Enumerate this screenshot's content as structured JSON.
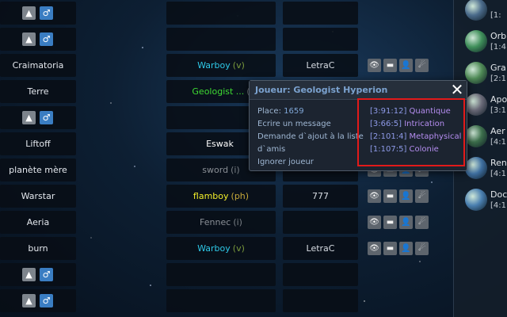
{
  "colors": {
    "player_cyan": "#2ec9e8",
    "player_green": "#3edb32",
    "player_yellow": "#f2ee2a",
    "player_white": "#ffffff",
    "player_grey": "#8a8f96",
    "rank_v": "#7a9a3c",
    "rank_ph": "#c7a93a",
    "rank_i": "#7a7f86",
    "highlight": "#e21a1a"
  },
  "rows": [
    {
      "type": "empty"
    },
    {
      "type": "empty"
    },
    {
      "type": "planet",
      "planet": "Craimatoria",
      "player": "Warboy",
      "rank": "(v)",
      "color": "player_cyan",
      "alliance": "LetraC",
      "actions": true
    },
    {
      "type": "planet",
      "planet": "Terre",
      "player": "Geologist ...",
      "rank": "(",
      "color": "player_green",
      "alliance": "",
      "actions": false
    },
    {
      "type": "empty"
    },
    {
      "type": "planet",
      "planet": "Liftoff",
      "player": "Eswak",
      "rank": "",
      "color": "player_white",
      "alliance": "",
      "actions": false
    },
    {
      "type": "planet",
      "planet": "planète mère",
      "player": "sword",
      "rank": "(i)",
      "color": "player_grey",
      "alliance": "",
      "actions": true
    },
    {
      "type": "planet",
      "planet": "Warstar",
      "player": "flamboy",
      "rank": "(ph)",
      "color": "player_yellow",
      "alliance": "777",
      "actions": true
    },
    {
      "type": "planet",
      "planet": "Aeria",
      "player": "Fennec",
      "rank": "(i)",
      "color": "player_grey",
      "alliance": "",
      "actions": true
    },
    {
      "type": "planet",
      "planet": "burn",
      "player": "Warboy",
      "rank": "(v)",
      "color": "player_cyan",
      "alliance": "LetraC",
      "actions": true
    },
    {
      "type": "empty"
    },
    {
      "type": "empty"
    }
  ],
  "popup": {
    "title": "Joueur: Geologist Hyperion",
    "close_icon": "close-icon",
    "place_label": "Place:",
    "place_value": "1659",
    "write_message": "Ecrire un message",
    "add_friend_line1": "Demande d`ajout à la liste",
    "add_friend_line2": "d`amis",
    "ignore": "Ignorer joueur",
    "planets": [
      {
        "coord": "[3:91:12]",
        "name": "Quantique"
      },
      {
        "coord": "[3:66:5]",
        "name": "Intrication"
      },
      {
        "coord": "[2:101:4]",
        "name": "Metaphysical"
      },
      {
        "coord": "[1:107:5]",
        "name": "Colonie"
      }
    ]
  },
  "right_panel": [
    {
      "name": "",
      "coord": "[1:"
    },
    {
      "name": "Orb",
      "coord": "[1:4"
    },
    {
      "name": "Gra",
      "coord": "[2:1"
    },
    {
      "name": "Apo",
      "coord": "[3:1"
    },
    {
      "name": "Aer",
      "coord": "[4:1"
    },
    {
      "name": "Ren",
      "coord": "[4:1"
    },
    {
      "name": "Doc",
      "coord": "[4:1"
    }
  ]
}
